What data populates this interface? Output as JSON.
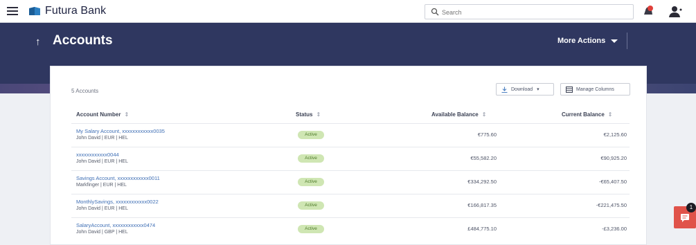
{
  "topbar": {
    "brand": "Futura Bank",
    "search_placeholder": "Search"
  },
  "header": {
    "title": "Accounts",
    "more_actions": "More Actions"
  },
  "card": {
    "count_label": "5 Accounts",
    "download_label": "Download",
    "manage_columns_label": "Manage Columns",
    "columns": [
      "Account Number",
      "Status",
      "Available Balance",
      "Current Balance"
    ],
    "rows": [
      {
        "name": "My Salary Account, xxxxxxxxxxxx0035",
        "sub": "John David | EUR | HEL",
        "status": "Active",
        "available": "€775.60",
        "current": "€2,125.60"
      },
      {
        "name": "xxxxxxxxxxxx0044",
        "sub": "John David | EUR | HEL",
        "status": "Active",
        "available": "€55,582.20",
        "current": "€90,925.20"
      },
      {
        "name": "Savings Account, xxxxxxxxxxxx0011",
        "sub": "Markfinger | EUR | HEL",
        "status": "Active",
        "available": "€334,292.50",
        "current": "-€65,407.50"
      },
      {
        "name": "MonthlySavings, xxxxxxxxxxxx0022",
        "sub": "John David | EUR | HEL",
        "status": "Active",
        "available": "€166,817.35",
        "current": "-€221,475.50"
      },
      {
        "name": "SalaryAccount, xxxxxxxxxxxx0474",
        "sub": "John David | GBP | HEL",
        "status": "Active",
        "available": "£484,775.10",
        "current": "-£3,236.00"
      }
    ]
  },
  "chat": {
    "badge_count": "1"
  },
  "colors": {
    "band": "#2f3760",
    "link": "#3f6fb5",
    "active_badge": "#cfe6b3",
    "chat": "#e0534a"
  }
}
